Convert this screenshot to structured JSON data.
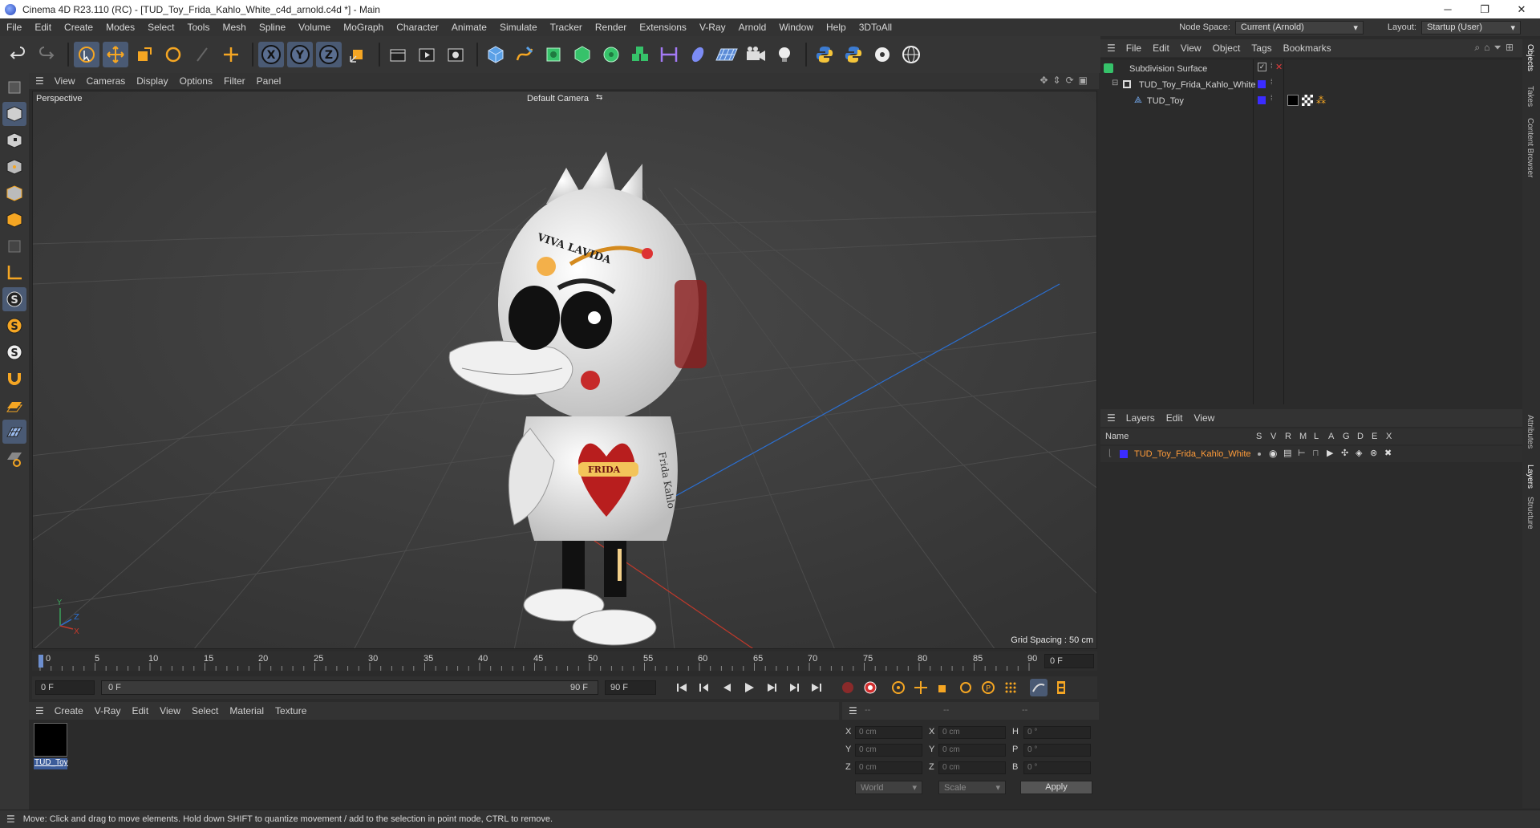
{
  "window": {
    "title": "Cinema 4D R23.110 (RC) - [TUD_Toy_Frida_Kahlo_White_c4d_arnold.c4d *] - Main",
    "minimize": "─",
    "maximize": "❐",
    "close": "✕"
  },
  "menu": {
    "items": [
      "File",
      "Edit",
      "Create",
      "Modes",
      "Select",
      "Tools",
      "Mesh",
      "Spline",
      "Volume",
      "MoGraph",
      "Character",
      "Animate",
      "Simulate",
      "Tracker",
      "Render",
      "Extensions",
      "V-Ray",
      "Arnold",
      "Window",
      "Help",
      "3DToAll"
    ],
    "node_space_label": "Node Space:",
    "node_space_value": "Current (Arnold)",
    "layout_label": "Layout:",
    "layout_value": "Startup (User)"
  },
  "viewport": {
    "menu": [
      "View",
      "Cameras",
      "Display",
      "Options",
      "Filter",
      "Panel"
    ],
    "perspective": "Perspective",
    "camera": "Default Camera",
    "grid_spacing": "Grid Spacing : 50 cm",
    "axis_y": "Y",
    "axis_z": "Z",
    "axis_x": "X",
    "model_text_top": "VIVA LAVIDA",
    "model_text_heart": "FRIDA",
    "model_text_side": "Frida Kahlo"
  },
  "timeline": {
    "ticks": [
      "0",
      "5",
      "10",
      "15",
      "20",
      "25",
      "30",
      "35",
      "40",
      "45",
      "50",
      "55",
      "60",
      "65",
      "70",
      "75",
      "80",
      "85",
      "90"
    ],
    "current_frame": "0 F",
    "start_field": "0 F",
    "range_start": "0 F",
    "range_end": "90 F",
    "end_field": "90 F"
  },
  "materials": {
    "menu": [
      "Create",
      "V-Ray",
      "Edit",
      "View",
      "Select",
      "Material",
      "Texture"
    ],
    "items": [
      {
        "name": "TUD_Toy"
      }
    ]
  },
  "coordinates": {
    "header": [
      "--",
      "--",
      "--"
    ],
    "rows": [
      {
        "l1": "X",
        "v1": "0 cm",
        "l2": "X",
        "v2": "0 cm",
        "l3": "H",
        "v3": "0 °"
      },
      {
        "l1": "Y",
        "v1": "0 cm",
        "l2": "Y",
        "v2": "0 cm",
        "l3": "P",
        "v3": "0 °"
      },
      {
        "l1": "Z",
        "v1": "0 cm",
        "l2": "Z",
        "v2": "0 cm",
        "l3": "B",
        "v3": "0 °"
      }
    ],
    "space": "World",
    "mode": "Scale",
    "apply": "Apply"
  },
  "status": {
    "text": "Move: Click and drag to move elements. Hold down SHIFT to quantize movement / add to the selection in point mode, CTRL to remove."
  },
  "objects": {
    "menu": [
      "File",
      "Edit",
      "View",
      "Object",
      "Tags",
      "Bookmarks"
    ],
    "rows": [
      {
        "name": "Subdivision Surface"
      },
      {
        "name": "TUD_Toy_Frida_Kahlo_White"
      },
      {
        "name": "TUD_Toy"
      }
    ]
  },
  "layers": {
    "menu": [
      "Layers",
      "Edit",
      "View"
    ],
    "header_name": "Name",
    "header_cols": [
      "S",
      "V",
      "R",
      "M",
      "L",
      "A",
      "G",
      "D",
      "E",
      "X"
    ],
    "rows": [
      {
        "name": "TUD_Toy_Frida_Kahlo_White"
      }
    ]
  },
  "side_tabs": [
    "Objects",
    "Takes",
    "Content Browser",
    "Attributes",
    "Layers",
    "Structure"
  ],
  "colors": {
    "accent": "#4a5a74",
    "layer_color": "#3b2cff",
    "layer_name_text": "#ff9c3a",
    "axis_x": "#c0392b",
    "axis_y": "#3aa35a",
    "axis_z": "#2b6fd1"
  }
}
